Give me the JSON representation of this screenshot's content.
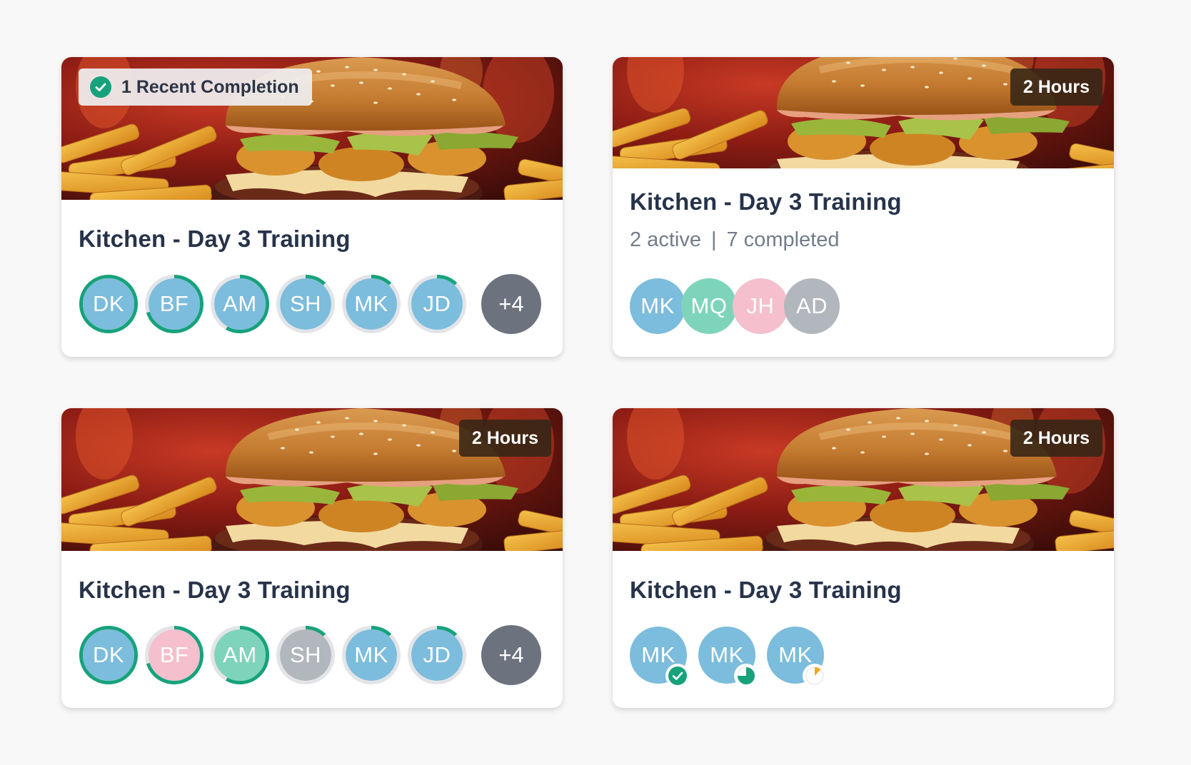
{
  "cards": [
    {
      "title": "Kitchen - Day 3 Training",
      "badge": "1 Recent Completion",
      "badge_icon": "check-circle-icon",
      "avatars": [
        {
          "initials": "DK",
          "progress": 1.0,
          "fill": "#7cbcdc"
        },
        {
          "initials": "BF",
          "progress": 0.7,
          "fill": "#7cbcdc"
        },
        {
          "initials": "AM",
          "progress": 0.58,
          "fill": "#7cbcdc"
        },
        {
          "initials": "SH",
          "progress": 0.12,
          "fill": "#7cbcdc"
        },
        {
          "initials": "MK",
          "progress": 0.12,
          "fill": "#7cbcdc"
        },
        {
          "initials": "JD",
          "progress": 0.12,
          "fill": "#7cbcdc"
        }
      ],
      "more": "+4"
    },
    {
      "title": "Kitchen - Day 3 Training",
      "badge": "2 Hours",
      "stats": {
        "active": "2 active",
        "separator": "|",
        "completed": "7 completed"
      },
      "avatars": [
        {
          "initials": "MK",
          "fill": "#7cbcdc"
        },
        {
          "initials": "MQ",
          "fill": "#7ed4bb"
        },
        {
          "initials": "JH",
          "fill": "#f5bfcd"
        },
        {
          "initials": "AD",
          "fill": "#b2b6bd"
        }
      ]
    },
    {
      "title": "Kitchen - Day 3 Training",
      "badge": "2 Hours",
      "avatars": [
        {
          "initials": "DK",
          "progress": 1.0,
          "fill": "#7cbcdc"
        },
        {
          "initials": "BF",
          "progress": 0.7,
          "fill": "#f5bfcd"
        },
        {
          "initials": "AM",
          "progress": 0.58,
          "fill": "#7ed4bb"
        },
        {
          "initials": "SH",
          "progress": 0.12,
          "fill": "#b2b6bd"
        },
        {
          "initials": "MK",
          "progress": 0.12,
          "fill": "#7cbcdc"
        },
        {
          "initials": "JD",
          "progress": 0.12,
          "fill": "#7cbcdc"
        }
      ],
      "more": "+4"
    },
    {
      "title": "Kitchen - Day 3 Training",
      "badge": "2 Hours",
      "avatars": [
        {
          "initials": "MK",
          "status": "complete",
          "status_icon": "check-circle-icon"
        },
        {
          "initials": "MK",
          "status": "in-progress",
          "progress": 0.75,
          "status_icon": "pie-progress-icon"
        },
        {
          "initials": "MK",
          "status": "started",
          "progress": 0.12,
          "status_icon": "pie-progress-icon"
        }
      ]
    }
  ],
  "colors": {
    "ring_progress": "#17a27c",
    "ring_track": "#e2e4e7",
    "status_started": "#f0a81c",
    "title": "#26334a",
    "more_bg": "#6c737f"
  }
}
